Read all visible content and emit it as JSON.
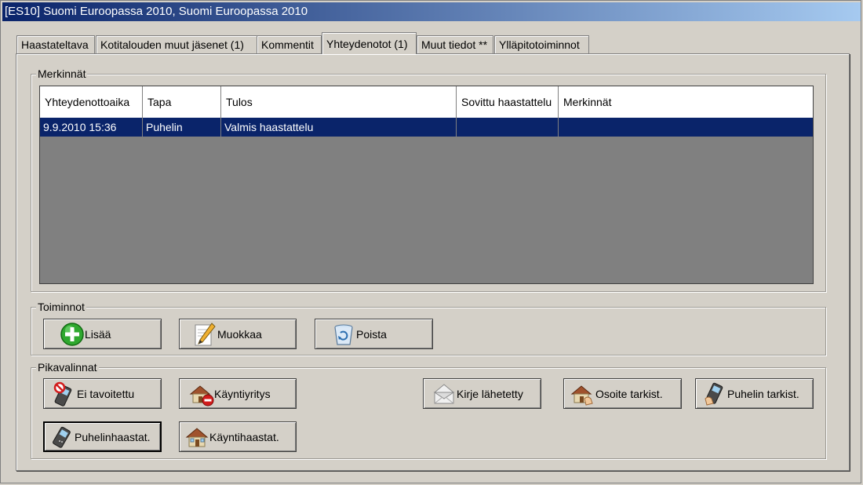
{
  "window": {
    "title": "[ES10] Suomi Euroopassa 2010, Suomi Euroopassa 2010"
  },
  "tabs": [
    {
      "label": "Haastateltava"
    },
    {
      "label": "Kotitalouden muut jäsenet (1)"
    },
    {
      "label": "Kommentit"
    },
    {
      "label": "Yhteydenotot (1)",
      "active": true
    },
    {
      "label": "Muut tiedot **"
    },
    {
      "label": "Ylläpitotoiminnot"
    }
  ],
  "merkinnat": {
    "label": "Merkinnät",
    "columns": [
      "Yhteydenottoaika",
      "Tapa",
      "Tulos",
      "Sovittu haastattelu",
      "Merkinnät"
    ],
    "rows": [
      {
        "time": "9.9.2010 15:36",
        "tapa": "Puhelin",
        "tulos": "Valmis haastattelu",
        "sovittu": "",
        "merkinnat": ""
      }
    ]
  },
  "toiminnot": {
    "label": "Toiminnot",
    "add": "Lisää",
    "edit": "Muokkaa",
    "delete": "Poista"
  },
  "pikavalinnat": {
    "label": "Pikavalinnat",
    "ei_tavoitettu": "Ei tavoitettu",
    "kayntiyritys": "Käyntiyritys",
    "kirje_lahetetty": "Kirje lähetetty",
    "osoite_tarkist": "Osoite tarkist.",
    "puhelin_tarkist": "Puhelin tarkist.",
    "puhelinhaastat": "Puhelinhaastat.",
    "kayntihaastat": "Käyntihaastat."
  },
  "colors": {
    "selection": "#0a246a",
    "grid_bg": "#808080",
    "face": "#d4d0c8"
  }
}
